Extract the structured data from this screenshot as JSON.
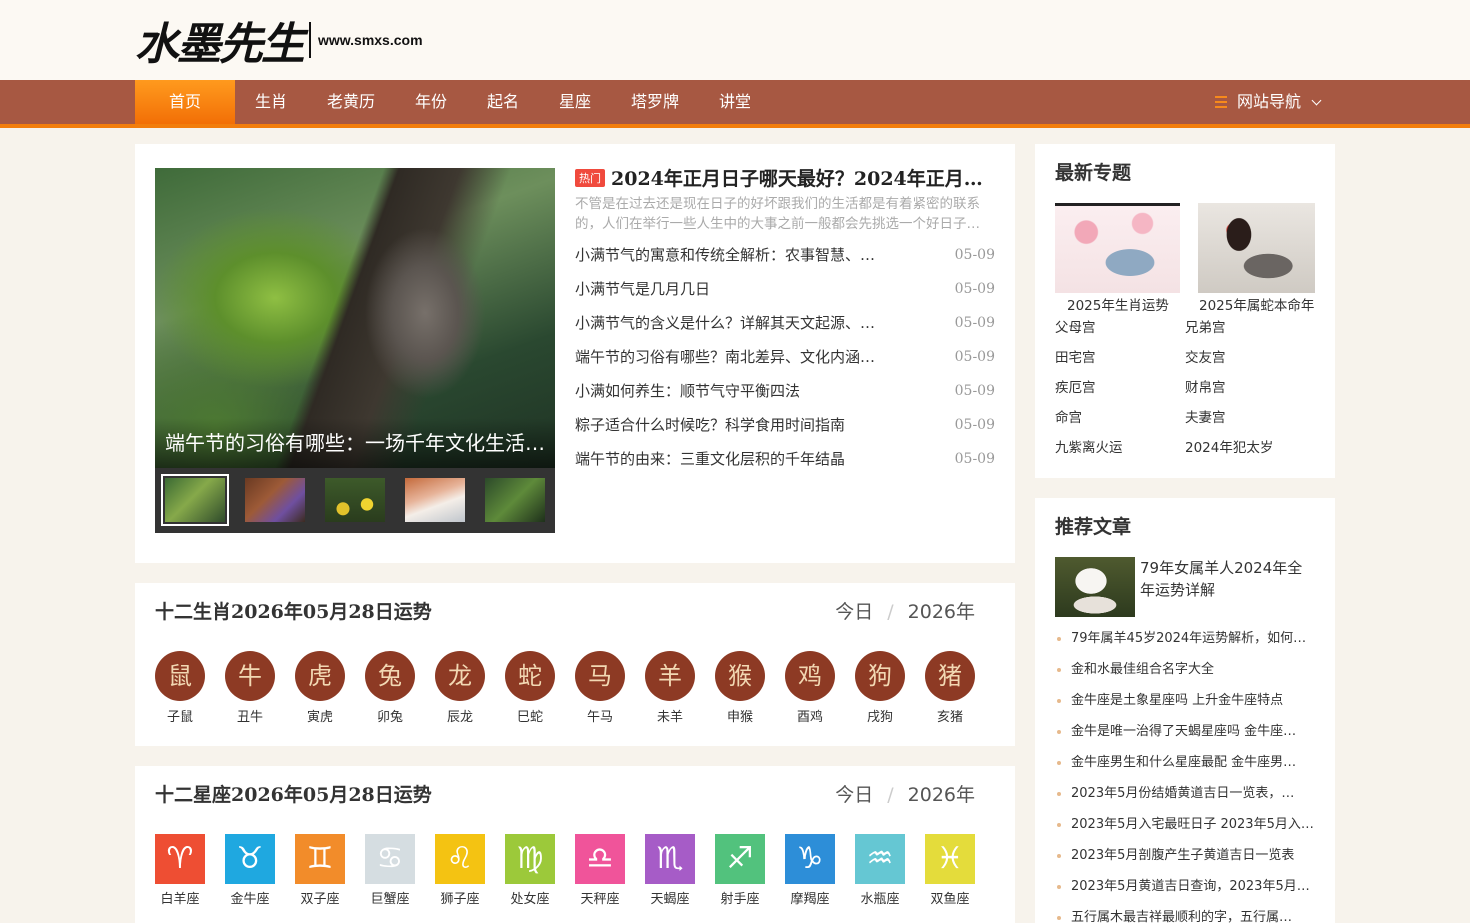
{
  "brand": {
    "name": "水墨先生",
    "url": "www.smxs.com"
  },
  "nav": {
    "items": [
      "首页",
      "生肖",
      "老黄历",
      "年份",
      "起名",
      "星座",
      "塔罗牌",
      "讲堂"
    ],
    "guide": "网站导航"
  },
  "hero": {
    "caption": "端午节的习俗有哪些：一场千年文化生活…",
    "hot_tag": "热门",
    "headline": "2024年正月日子哪天最好？2024年正月最…",
    "desc": "不管是在过去还是现在日子的好坏跟我们的生活都是有着紧密的联系的，人们在举行一些人生中的大事之前一般都会先挑选一个好日子…",
    "news": [
      {
        "title": "小满节气的寓意和传统全解析：农事智慧、…",
        "date": "05-09"
      },
      {
        "title": "小满节气是几月几日",
        "date": "05-09"
      },
      {
        "title": "小满节气的含义是什么？详解其天文起源、…",
        "date": "05-09"
      },
      {
        "title": "端午节的习俗有哪些？南北差异、文化内涵…",
        "date": "05-09"
      },
      {
        "title": "小满如何养生：顺节气守平衡四法",
        "date": "05-09"
      },
      {
        "title": "粽子适合什么时候吃？科学食用时间指南",
        "date": "05-09"
      },
      {
        "title": "端午节的由来：三重文化层积的千年结晶",
        "date": "05-09"
      }
    ]
  },
  "zodiac": {
    "title": "十二生肖2026年05月28日运势",
    "tab_today": "今日",
    "tab_sep": "/",
    "tab_year": "2026年",
    "animals": [
      {
        "name": "子鼠",
        "glyph": "鼠"
      },
      {
        "name": "丑牛",
        "glyph": "牛"
      },
      {
        "name": "寅虎",
        "glyph": "虎"
      },
      {
        "name": "卯兔",
        "glyph": "兔"
      },
      {
        "name": "辰龙",
        "glyph": "龙"
      },
      {
        "name": "巳蛇",
        "glyph": "蛇"
      },
      {
        "name": "午马",
        "glyph": "马"
      },
      {
        "name": "未羊",
        "glyph": "羊"
      },
      {
        "name": "申猴",
        "glyph": "猴"
      },
      {
        "name": "酉鸡",
        "glyph": "鸡"
      },
      {
        "name": "戌狗",
        "glyph": "狗"
      },
      {
        "name": "亥猪",
        "glyph": "猪"
      }
    ]
  },
  "constellation": {
    "title": "十二星座2026年05月28日运势",
    "tab_today": "今日",
    "tab_sep": "/",
    "tab_year": "2026年",
    "signs": [
      {
        "name": "白羊座",
        "glyph": "♈",
        "color": "#ee4e33"
      },
      {
        "name": "金牛座",
        "glyph": "♉",
        "color": "#1fa8e0"
      },
      {
        "name": "双子座",
        "glyph": "♊",
        "color": "#f28c2a"
      },
      {
        "name": "巨蟹座",
        "glyph": "♋",
        "color": "#d5dde1"
      },
      {
        "name": "狮子座",
        "glyph": "♌",
        "color": "#f4c312"
      },
      {
        "name": "处女座",
        "glyph": "♍",
        "color": "#9cc93a"
      },
      {
        "name": "天秤座",
        "glyph": "♎",
        "color": "#f0549a"
      },
      {
        "name": "天蝎座",
        "glyph": "♏",
        "color": "#a65cc7"
      },
      {
        "name": "射手座",
        "glyph": "♐",
        "color": "#52c27d"
      },
      {
        "name": "摩羯座",
        "glyph": "♑",
        "color": "#2d8ed8"
      },
      {
        "name": "水瓶座",
        "glyph": "♒",
        "color": "#65c7d3"
      },
      {
        "name": "双鱼座",
        "glyph": "♓",
        "color": "#e4dc3b"
      }
    ]
  },
  "topics": {
    "title": "最新专题",
    "featured": [
      "2025年生肖运势",
      "2025年属蛇本命年"
    ],
    "links": [
      "父母宫",
      "兄弟宫",
      "田宅宫",
      "交友宫",
      "疾厄宫",
      "财帛宫",
      "命宫",
      "夫妻宫",
      "九紫离火运",
      "2024年犯太岁"
    ]
  },
  "recommend": {
    "title": "推荐文章",
    "top": "79年女属羊人2024年全年运势详解",
    "items": [
      "79年属羊45岁2024年运势解析，如何…",
      "金和水最佳组合名字大全",
      "金牛座是土象星座吗 上升金牛座特点",
      "金牛是唯一治得了天蝎星座吗 金牛座…",
      "金牛座男生和什么星座最配 金牛座男…",
      "2023年5月份结婚黄道吉日一览表，…",
      "2023年5月入宅最旺日子 2023年5月入…",
      "2023年5月剖腹产生子黄道吉日一览表",
      "2023年5月黄道吉日查询，2023年5月…",
      "五行属木最吉祥最顺利的字，五行属…"
    ]
  }
}
